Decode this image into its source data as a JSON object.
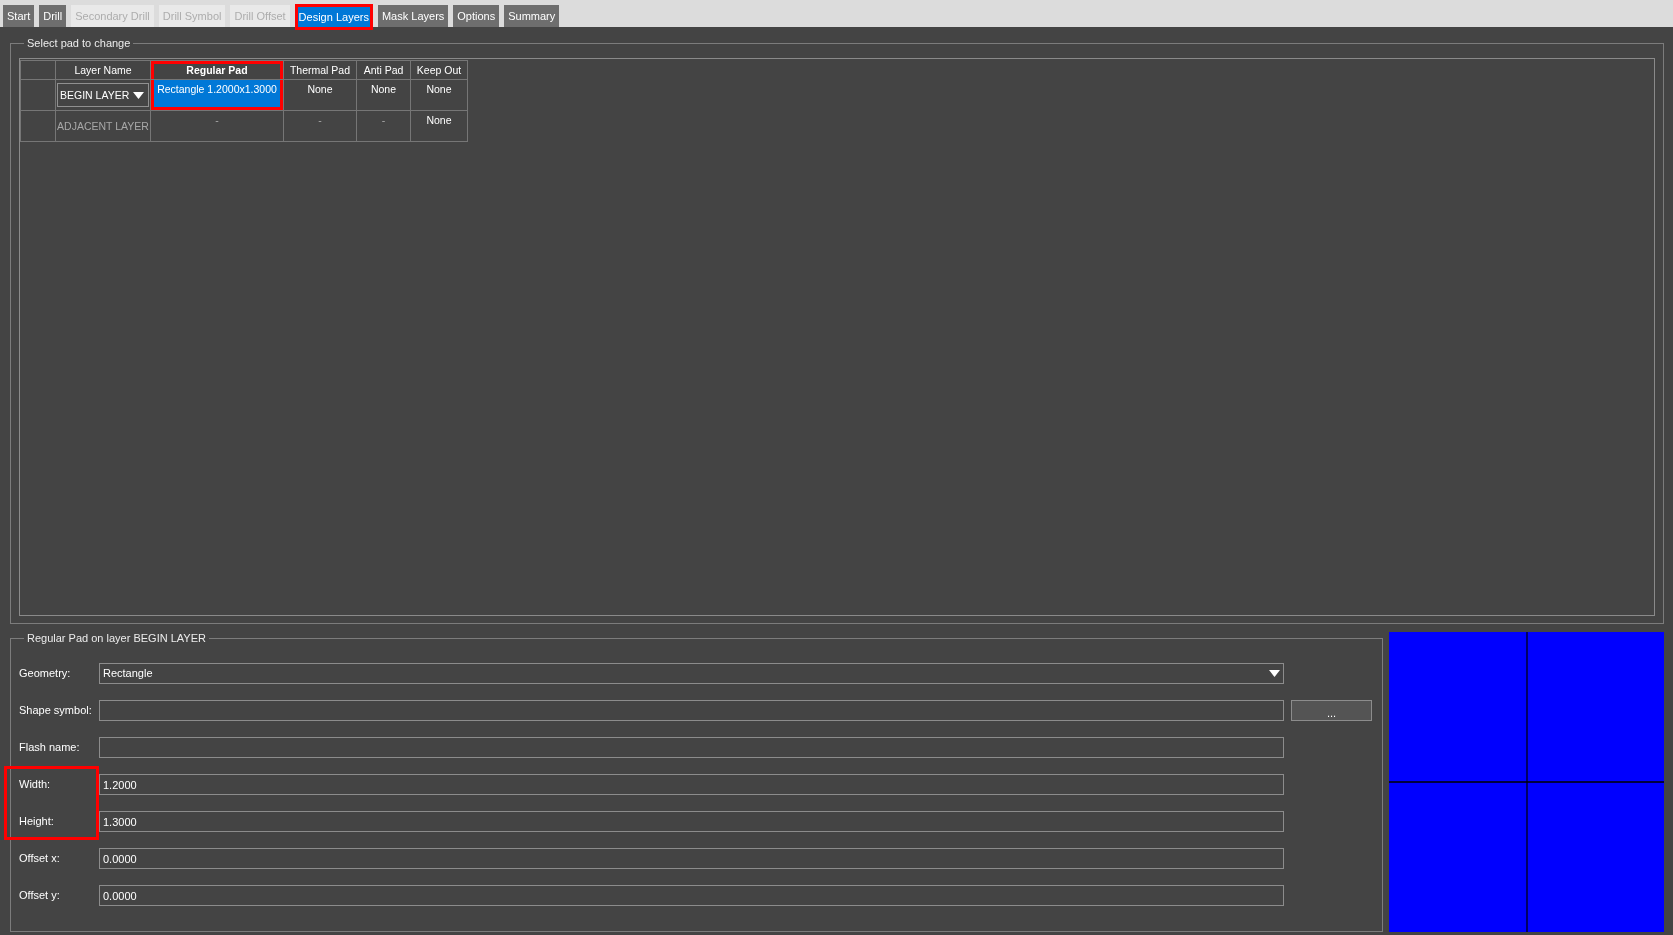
{
  "tabs": [
    {
      "label": "Start",
      "selected": false,
      "disabled": false,
      "highlighted": false
    },
    {
      "label": "Drill",
      "selected": false,
      "disabled": false,
      "highlighted": false
    },
    {
      "label": "Secondary Drill",
      "selected": false,
      "disabled": true,
      "highlighted": false
    },
    {
      "label": "Drill Symbol",
      "selected": false,
      "disabled": true,
      "highlighted": false
    },
    {
      "label": "Drill Offset",
      "selected": false,
      "disabled": true,
      "highlighted": false
    },
    {
      "label": "Design Layers",
      "selected": true,
      "disabled": false,
      "highlighted": true
    },
    {
      "label": "Mask Layers",
      "selected": false,
      "disabled": false,
      "highlighted": false
    },
    {
      "label": "Options",
      "selected": false,
      "disabled": false,
      "highlighted": false
    },
    {
      "label": "Summary",
      "selected": false,
      "disabled": false,
      "highlighted": false
    }
  ],
  "pad_selection": {
    "title": "Select pad to change",
    "columns": [
      {
        "label": "Layer Name",
        "selected": false,
        "highlighted": false
      },
      {
        "label": "Regular Pad",
        "selected": true,
        "highlighted": true
      },
      {
        "label": "Thermal Pad",
        "selected": false,
        "highlighted": false
      },
      {
        "label": "Anti Pad",
        "selected": false,
        "highlighted": false
      },
      {
        "label": "Keep Out",
        "selected": false,
        "highlighted": false
      }
    ],
    "rows": [
      {
        "cells": [
          {
            "text": "BEGIN LAYER",
            "kind": "dropdown",
            "selected": false,
            "disabled": false,
            "highlighted": false
          },
          {
            "text": "Rectangle 1.2000x1.3000",
            "kind": "text",
            "selected": true,
            "disabled": false,
            "highlighted": true
          },
          {
            "text": "None",
            "kind": "text",
            "selected": false,
            "disabled": false,
            "highlighted": false
          },
          {
            "text": "None",
            "kind": "text",
            "selected": false,
            "disabled": false,
            "highlighted": false
          },
          {
            "text": "None",
            "kind": "text",
            "selected": false,
            "disabled": false,
            "highlighted": false
          }
        ]
      },
      {
        "cells": [
          {
            "text": "ADJACENT LAYER",
            "kind": "text",
            "selected": false,
            "disabled": true,
            "highlighted": false
          },
          {
            "text": "-",
            "kind": "text",
            "selected": false,
            "disabled": true,
            "highlighted": false
          },
          {
            "text": "-",
            "kind": "text",
            "selected": false,
            "disabled": true,
            "highlighted": false
          },
          {
            "text": "-",
            "kind": "text",
            "selected": false,
            "disabled": true,
            "highlighted": false
          },
          {
            "text": "None",
            "kind": "text",
            "selected": false,
            "disabled": false,
            "highlighted": false
          }
        ]
      }
    ]
  },
  "pad_editor": {
    "title": "Regular Pad on layer BEGIN LAYER",
    "fields": [
      {
        "label": "Geometry:",
        "kind": "dropdown",
        "value": "Rectangle",
        "highlighted": false
      },
      {
        "label": "Shape symbol:",
        "kind": "text",
        "button": "...",
        "highlighted": false
      },
      {
        "label": "Flash name:",
        "kind": "text",
        "highlighted": false
      },
      {
        "label": "Width:",
        "kind": "text",
        "value": "1.2000",
        "highlighted": true
      },
      {
        "label": "Height:",
        "kind": "text",
        "value": "1.3000",
        "highlighted": true
      },
      {
        "label": "Offset x:",
        "kind": "text",
        "value": "0.0000",
        "highlighted": false
      },
      {
        "label": "Offset y:",
        "kind": "text",
        "value": "0.0000",
        "highlighted": false
      }
    ]
  }
}
